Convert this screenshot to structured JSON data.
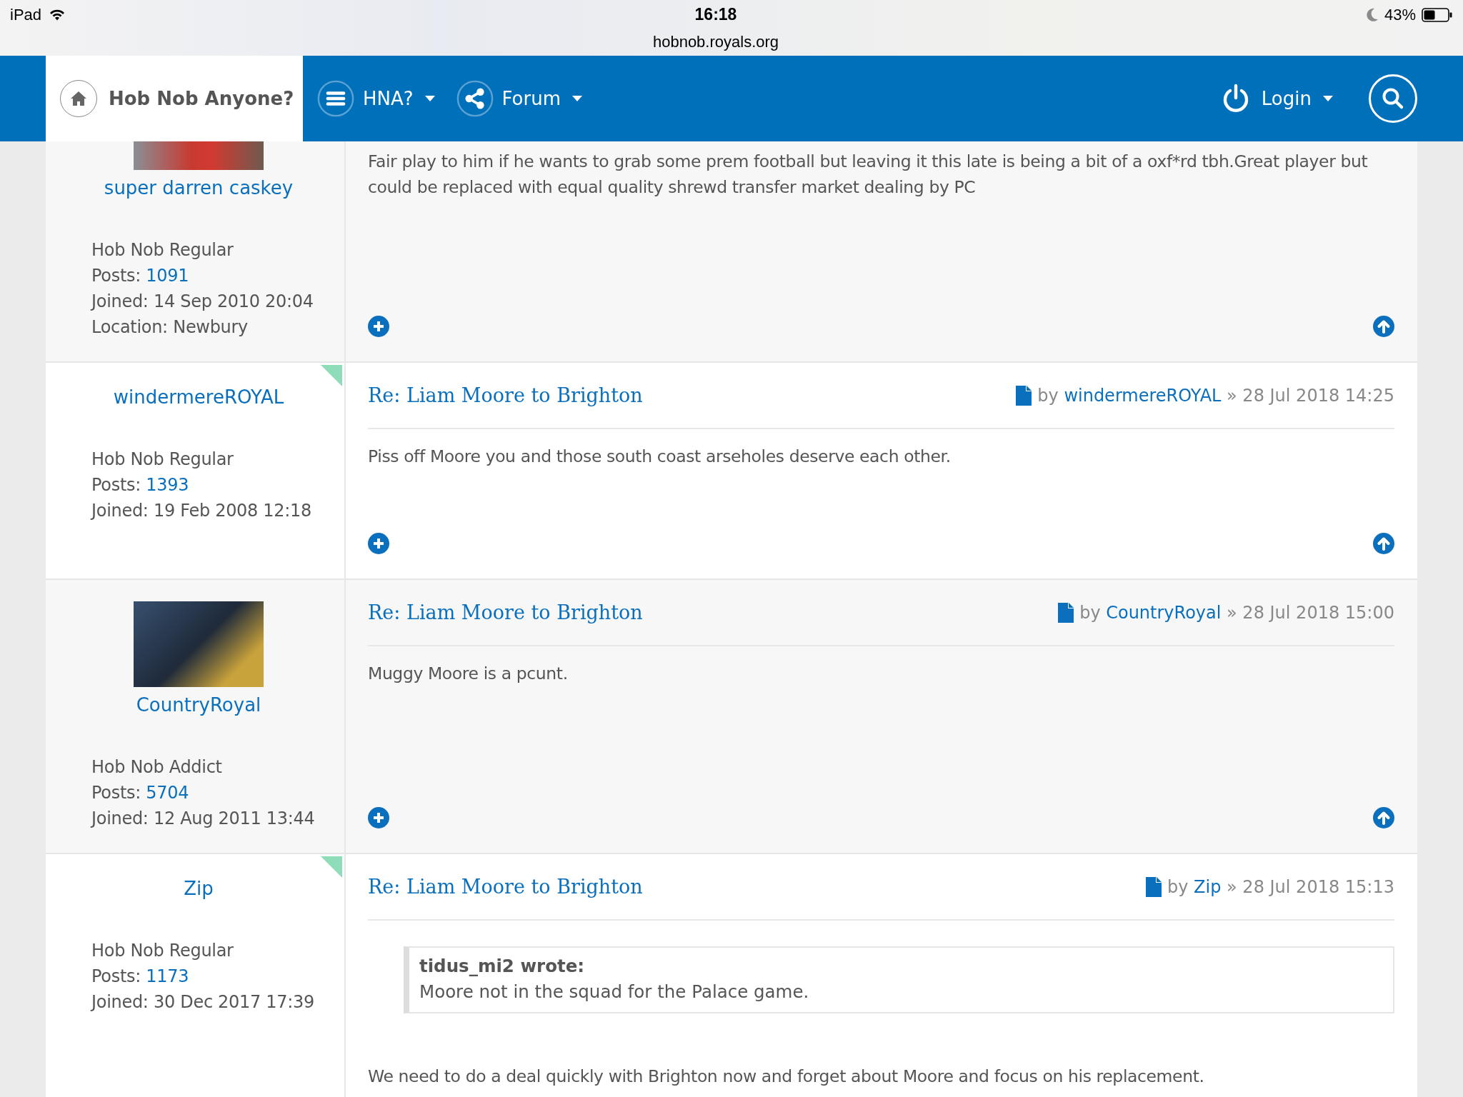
{
  "status_bar": {
    "device": "iPad",
    "time": "16:18",
    "url": "hobnob.royals.org",
    "battery": "43%"
  },
  "navbar": {
    "brand": "Hob Nob Anyone?",
    "menus": [
      {
        "label": "HNA?"
      },
      {
        "label": "Forum"
      }
    ],
    "login": "Login"
  },
  "posts": [
    {
      "author": "super darren caskey",
      "avatar": true,
      "online": false,
      "rank": "Hob Nob Regular",
      "details": [
        {
          "label": "Posts:",
          "value": "1091",
          "link": true
        },
        {
          "label": "Joined:",
          "value": "14 Sep 2010 20:04",
          "link": false
        },
        {
          "label": "Location:",
          "value": "Newbury",
          "link": false
        }
      ],
      "body": [
        {
          "kind": "text",
          "actions": true,
          "text": "Fair play to him if he wants to grab some prem football but leaving it this late is being a bit of a oxf*rd tbh.Great player but could be replaced with equal quality shrewd transfer market dealing by PC"
        }
      ]
    },
    {
      "author": "windermereROYAL",
      "online": true,
      "rank": "Hob Nob Regular",
      "details": [
        {
          "label": "Posts:",
          "value": "1393",
          "link": true
        },
        {
          "label": "Joined:",
          "value": "19 Feb 2008 12:18",
          "link": false
        }
      ],
      "title": "Re: Liam Moore to Brighton",
      "meta": {
        "prefix": "by",
        "author": "windermereROYAL",
        "date": "» 28 Jul 2018 14:25"
      },
      "body": [
        {
          "kind": "text",
          "actions": true,
          "text": "Piss off Moore you and those south coast arseholes deserve each other."
        }
      ]
    },
    {
      "author": "CountryRoyal",
      "avatar": true,
      "online": false,
      "rank": "Hob Nob Addict",
      "details": [
        {
          "label": "Posts:",
          "value": "5704",
          "link": true
        },
        {
          "label": "Joined:",
          "value": "12 Aug 2011 13:44",
          "link": false
        }
      ],
      "title": "Re: Liam Moore to Brighton",
      "meta": {
        "prefix": "by",
        "author": "CountryRoyal",
        "date": "» 28 Jul 2018 15:00"
      },
      "body": [
        {
          "kind": "text",
          "actions": true,
          "text": "Muggy Moore is a pcunt."
        }
      ]
    },
    {
      "author": "Zip",
      "online": true,
      "rank": "Hob Nob Regular",
      "details": [
        {
          "label": "Posts:",
          "value": "1173",
          "link": true
        },
        {
          "label": "Joined:",
          "value": "30 Dec 2017 17:39",
          "link": false
        }
      ],
      "title": "Re: Liam Moore to Brighton",
      "meta": {
        "prefix": "by",
        "author": "Zip",
        "date": "» 28 Jul 2018 15:13"
      },
      "body": [
        {
          "kind": "quote",
          "author": "tidus_mi2 wrote:",
          "text": "Moore not in the squad for the Palace game."
        },
        {
          "kind": "text",
          "text": "We need to do a deal quickly with Brighton now and forget about Moore and focus on his replacement."
        }
      ]
    }
  ]
}
